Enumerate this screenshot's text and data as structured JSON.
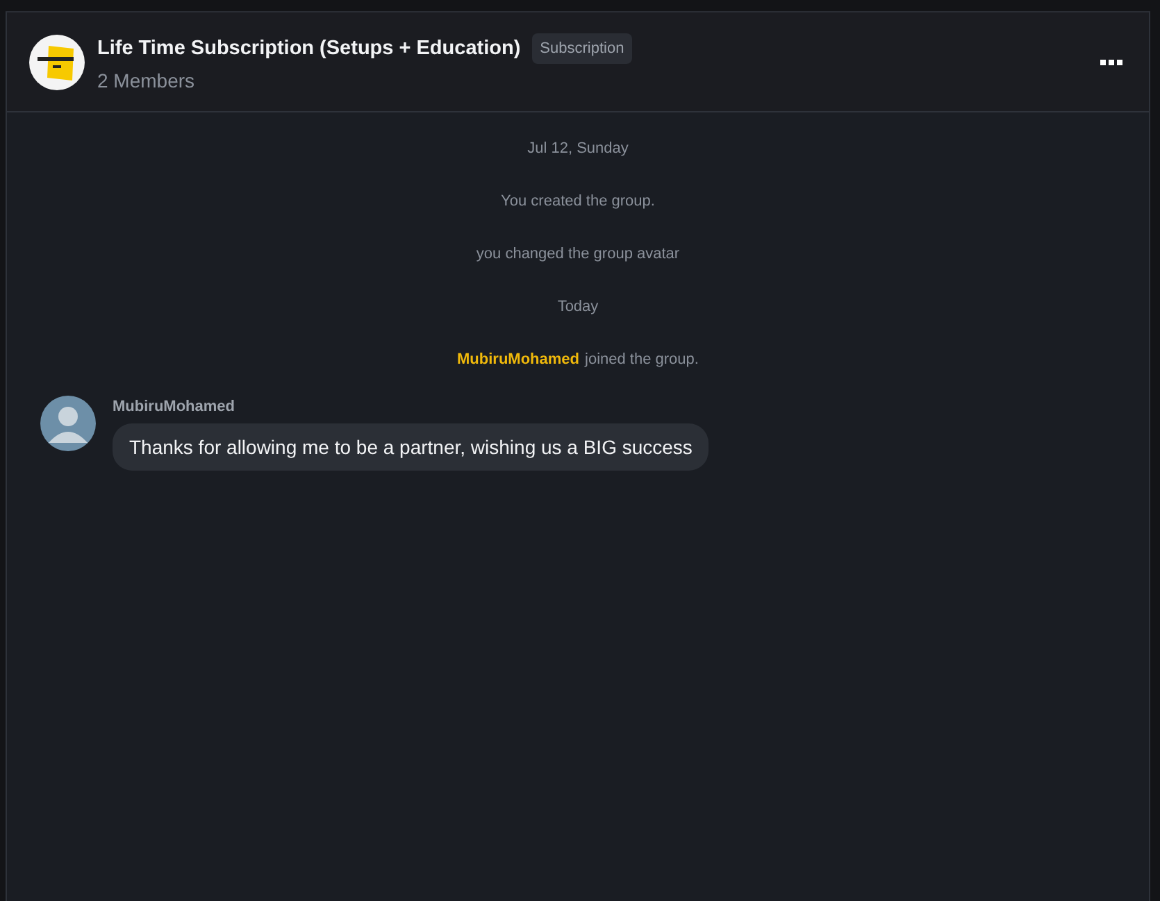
{
  "header": {
    "title": "Life Time Subscription (Setups + Education)",
    "badge": "Subscription",
    "members": "2 Members"
  },
  "timeline": [
    {
      "kind": "date",
      "text": "Jul 12, Sunday"
    },
    {
      "kind": "event",
      "text": "You created the group."
    },
    {
      "kind": "event",
      "text": "you changed the group avatar"
    },
    {
      "kind": "date",
      "text": "Today"
    },
    {
      "kind": "event",
      "actor": "MubiruMohamed",
      "text": "joined the group."
    },
    {
      "kind": "message",
      "sender": "MubiruMohamed",
      "text": "Thanks for allowing me to be a partner, wishing us a BIG success"
    }
  ]
}
